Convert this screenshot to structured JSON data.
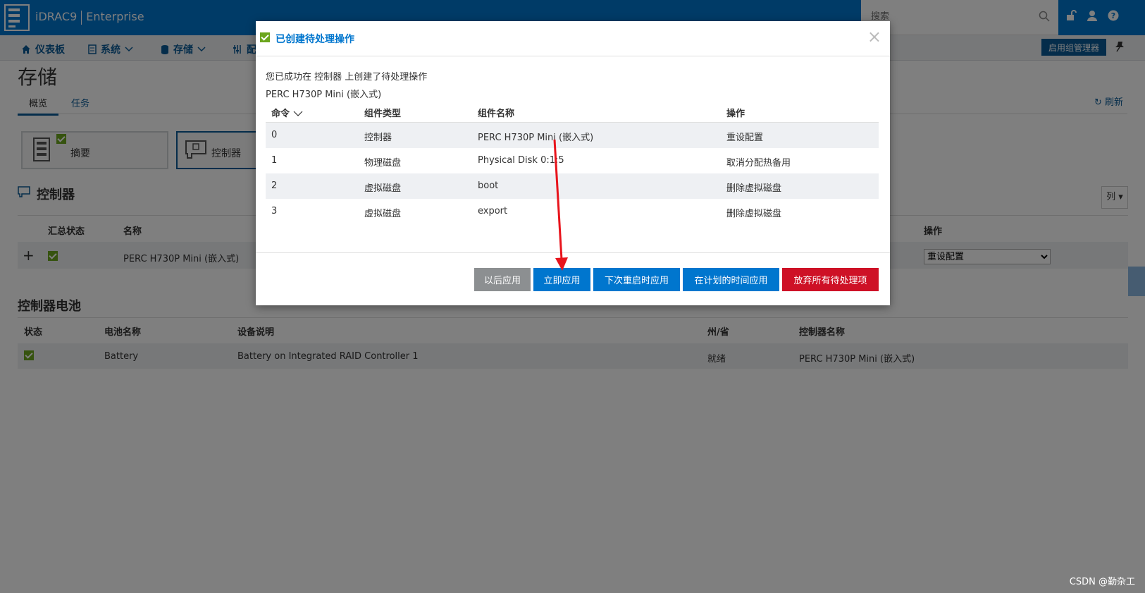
{
  "header": {
    "product": "iDRAC9",
    "edition": "Enterprise",
    "search_placeholder": "搜索"
  },
  "nav": {
    "items": [
      "仪表板",
      "系统",
      "存储",
      "配"
    ],
    "enable_group_manager": "启用组管理器"
  },
  "page": {
    "title": "存储",
    "tabs": [
      "概览",
      "任务"
    ],
    "refresh": "刷新",
    "cards": [
      "摘要",
      "控制器"
    ]
  },
  "controllers": {
    "title": "控制器",
    "column_button": "列",
    "headers": [
      "汇总状态",
      "名称",
      "操作"
    ],
    "row": {
      "expand": "+",
      "name": "PERC H730P Mini (嵌入式)",
      "action": "重设配置"
    }
  },
  "battery": {
    "title": "控制器电池",
    "headers": [
      "状态",
      "电池名称",
      "设备说明",
      "州/省",
      "控制器名称"
    ],
    "row": {
      "name": "Battery",
      "description": "Battery on Integrated RAID Controller 1",
      "state": "就绪",
      "controller": "PERC H730P Mini (嵌入式)"
    }
  },
  "modal": {
    "title": "已创建待处理操作",
    "close": "×",
    "message": "您已成功在 控制器 上创建了待处理操作",
    "controller": "PERC H730P Mini (嵌入式)",
    "headers": [
      "命令",
      "组件类型",
      "组件名称",
      "操作"
    ],
    "rows": [
      [
        "0",
        "控制器",
        "PERC H730P Mini (嵌入式)",
        "重设配置"
      ],
      [
        "1",
        "物理磁盘",
        "Physical Disk 0:1:5",
        "取消分配热备用"
      ],
      [
        "2",
        "虚拟磁盘",
        "boot",
        "删除虚拟磁盘"
      ],
      [
        "3",
        "虚拟磁盘",
        "export",
        "删除虚拟磁盘"
      ]
    ],
    "buttons": {
      "later": "以后应用",
      "now": "立即应用",
      "next_reboot": "下次重启时应用",
      "scheduled": "在计划的时间应用",
      "discard": "放弃所有待处理项"
    }
  },
  "watermark": "CSDN @勤杂工",
  "colors": {
    "brand_blue": "#0076ce",
    "danger": "#ce1126",
    "ok_green": "#6ca61e",
    "annotation_arrow": "#e8141c"
  }
}
